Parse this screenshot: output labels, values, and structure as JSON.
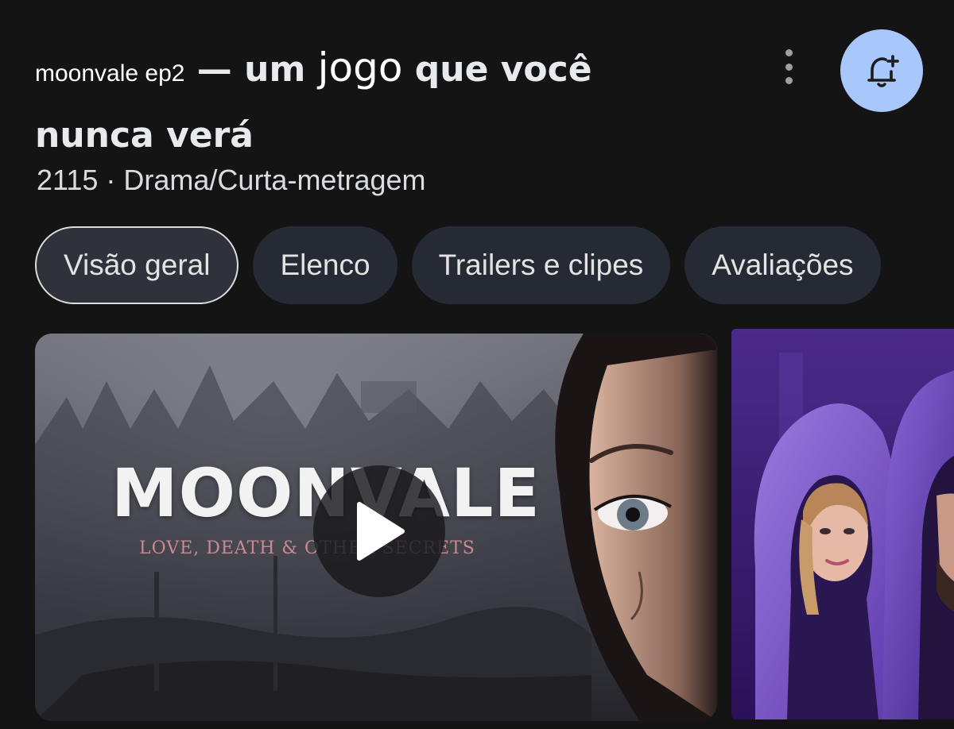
{
  "title": {
    "prefix": "moonvale ep2",
    "dash": "—",
    "word_um": "um",
    "word_jogo": "jogo",
    "word_que_voce": "que você",
    "line2": "nunca verá"
  },
  "subtitle": "2115 · Drama/Curta-metragem",
  "tabs": [
    {
      "label": "Visão geral",
      "active": true
    },
    {
      "label": "Elenco",
      "active": false
    },
    {
      "label": "Trailers e clipes",
      "active": false
    },
    {
      "label": "Avaliações",
      "active": false
    }
  ],
  "video": {
    "title_text": "MOONVALE",
    "tagline_text": "LOVE, DEATH & OTHER SECRETS"
  },
  "icons": {
    "menu": "more-vert-icon",
    "notify": "bell-add-icon",
    "play": "play-icon"
  },
  "colors": {
    "background": "#141414",
    "bell_button": "#a8c7fa",
    "tab_bg": "#262a34",
    "active_tab_border": "#dcdcdc",
    "tagline": "#c98a92"
  }
}
